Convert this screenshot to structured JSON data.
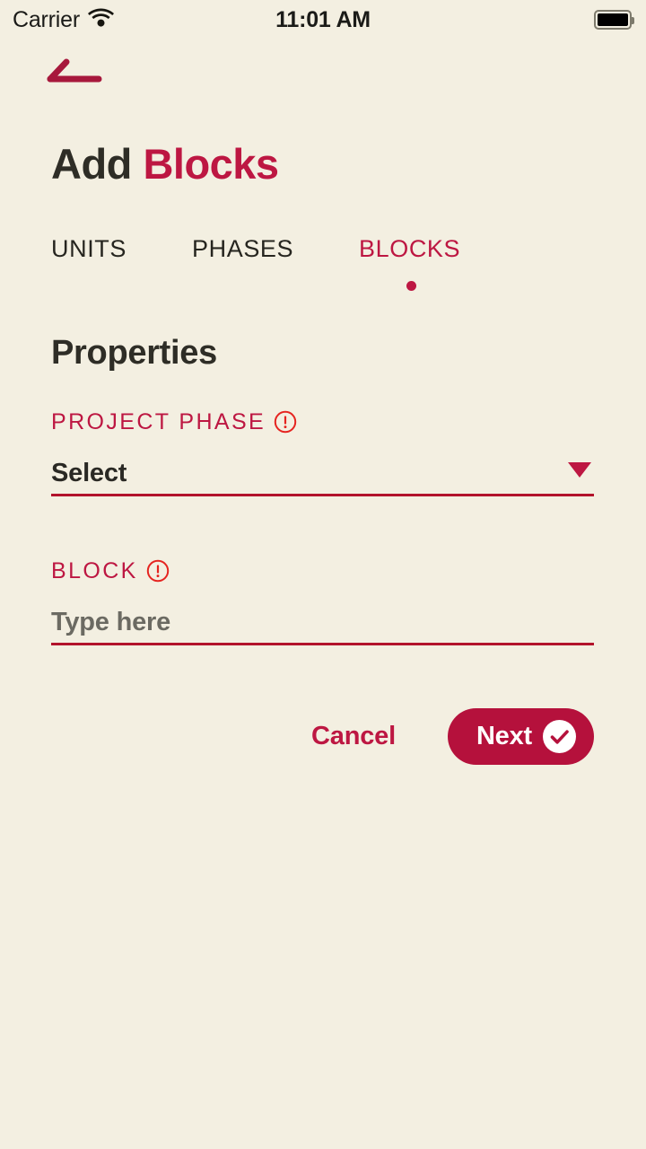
{
  "colors": {
    "background": "#f3efe1",
    "accent": "#bd1742",
    "accent_button": "#b5113c",
    "underline": "#b2132b",
    "alert_red": "#e52420",
    "text_dark": "#2e2d26",
    "placeholder": "#6b6a62"
  },
  "status_bar": {
    "carrier": "Carrier",
    "wifi_icon": "wifi-icon",
    "time": "11:01 AM",
    "battery_icon": "battery-full-icon"
  },
  "nav": {
    "back_icon": "back-arrow-icon"
  },
  "header": {
    "title_primary": "Add",
    "title_accent": "Blocks"
  },
  "tabs": {
    "items": [
      {
        "label": "UNITS",
        "active": false
      },
      {
        "label": "PHASES",
        "active": false
      },
      {
        "label": "BLOCKS",
        "active": true
      }
    ],
    "active_indicator": "active-tab-dot"
  },
  "main": {
    "section_title": "Properties",
    "fields": [
      {
        "label": "PROJECT PHASE",
        "required_icon": "alert-circle-icon",
        "type": "select",
        "value": "Select",
        "is_placeholder": true,
        "dropdown_icon": "chevron-down-icon"
      },
      {
        "label": "BLOCK",
        "required_icon": "alert-circle-icon",
        "type": "text",
        "value": "",
        "placeholder": "Type here",
        "is_placeholder": true
      }
    ]
  },
  "actions": {
    "cancel_label": "Cancel",
    "next_label": "Next",
    "next_icon": "check-circle-icon"
  }
}
